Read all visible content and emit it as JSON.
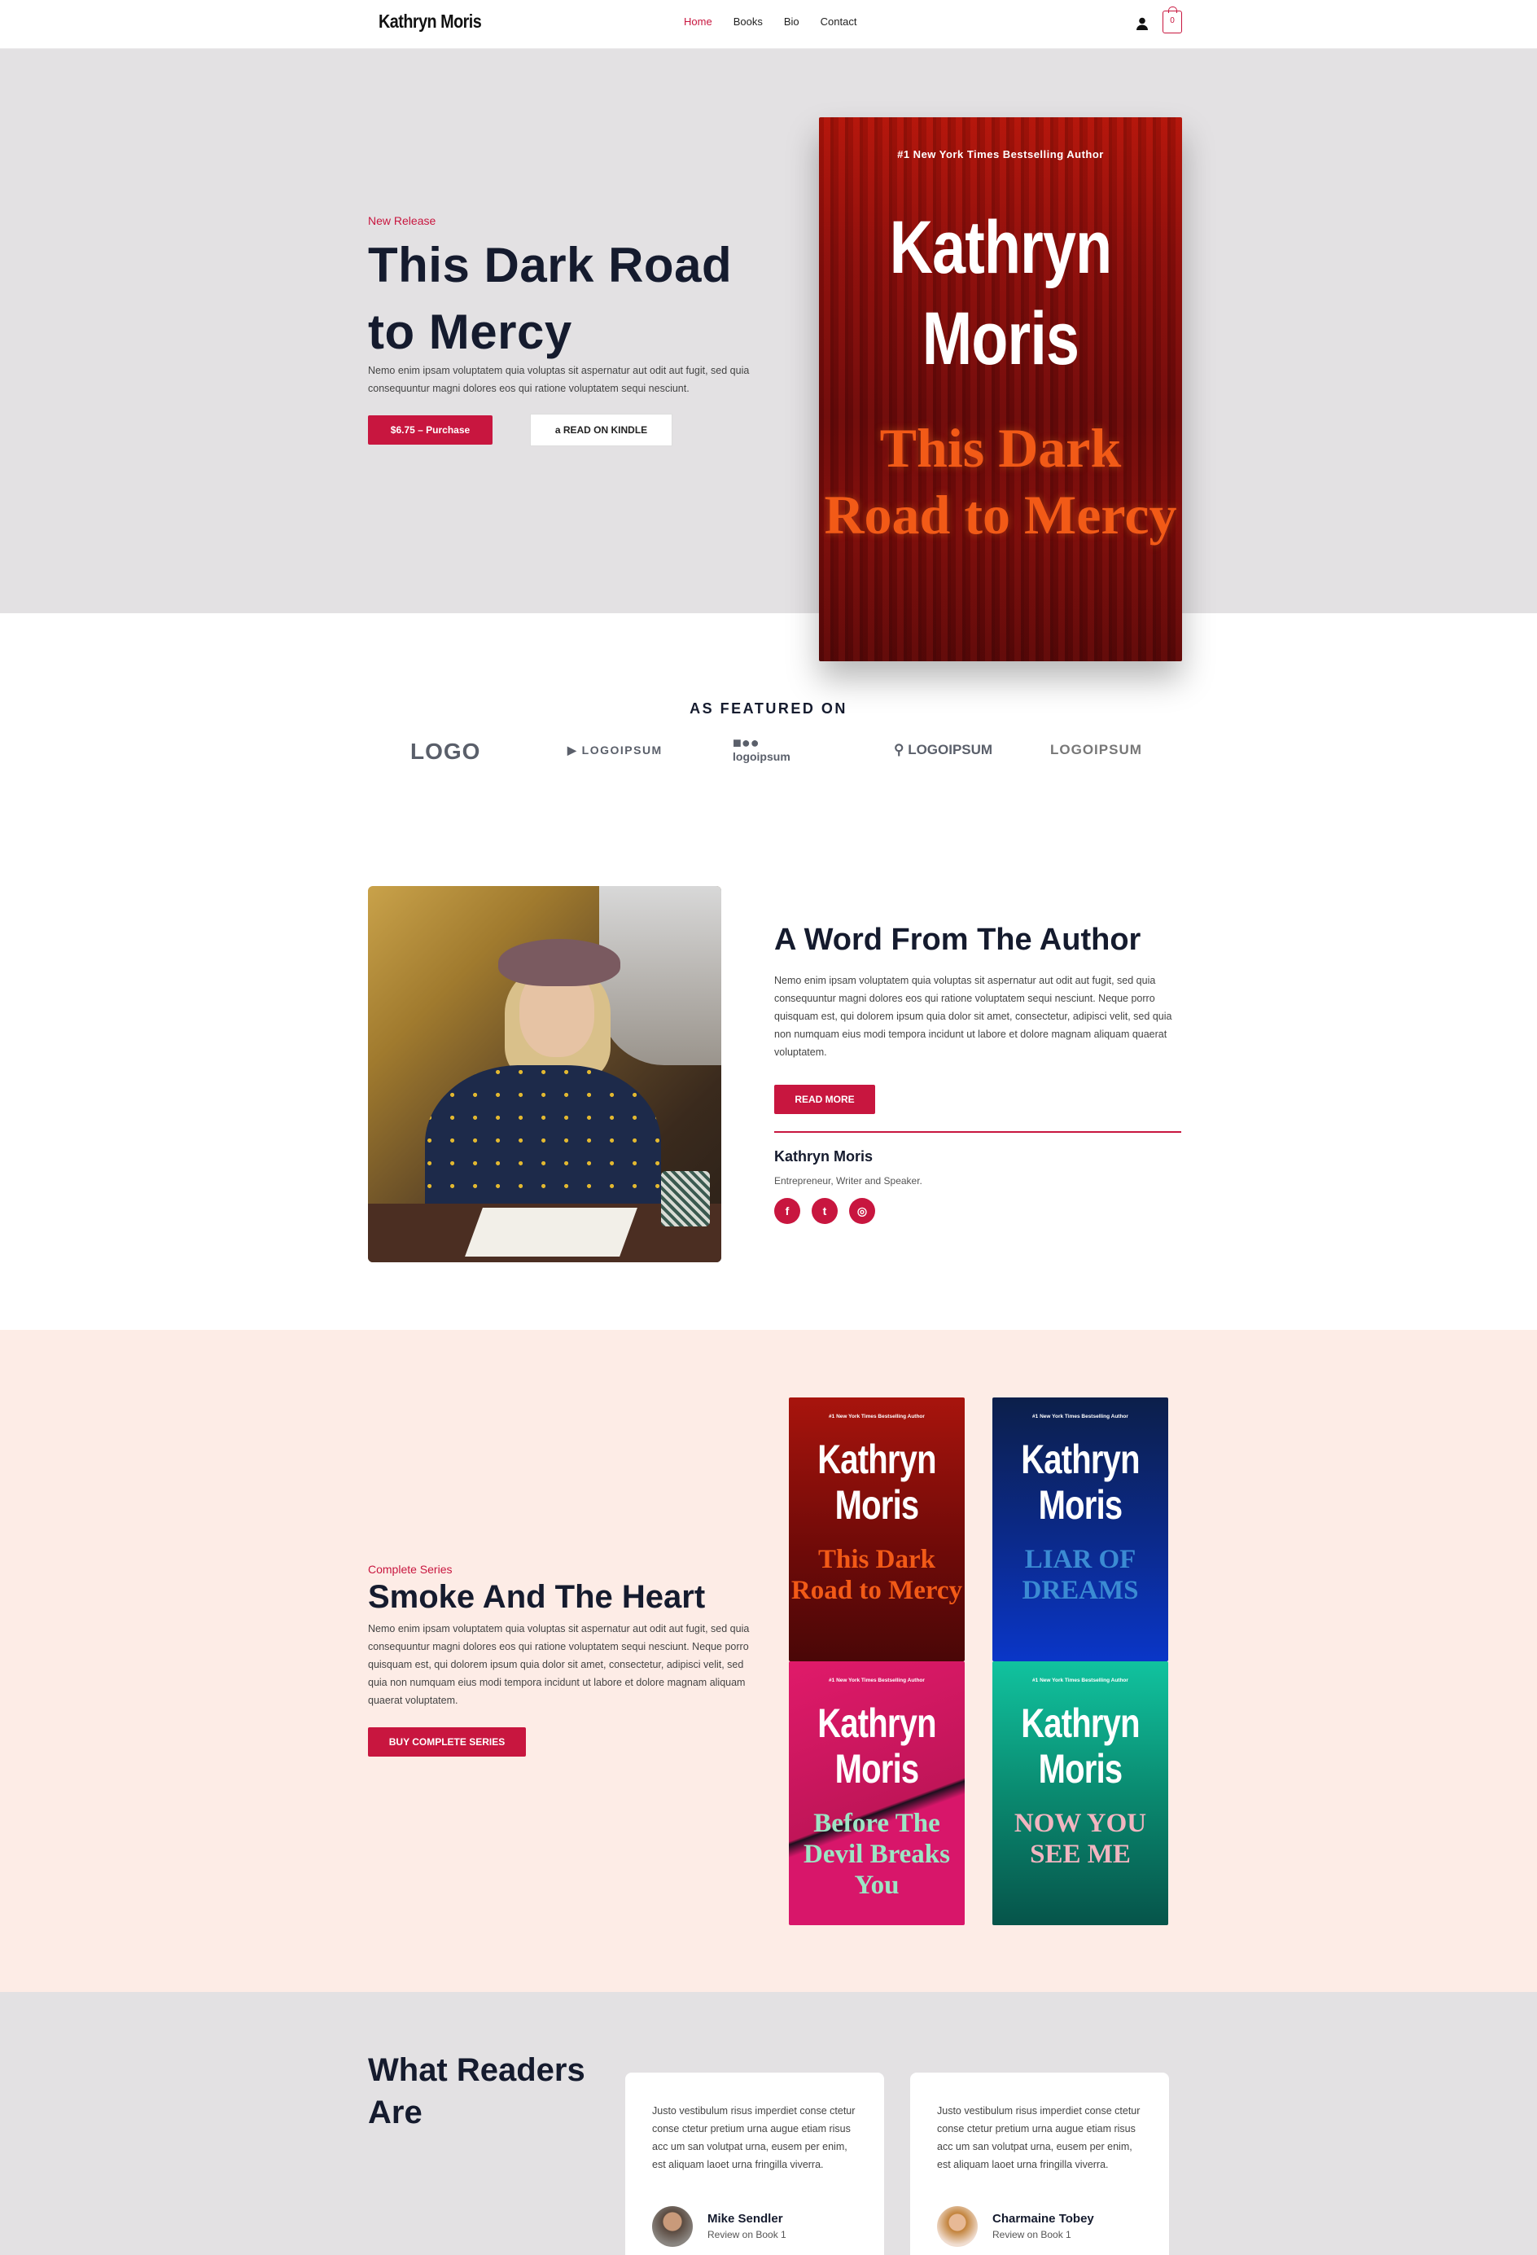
{
  "header": {
    "brand": "Kathryn Moris",
    "nav": [
      {
        "label": "Home",
        "active": true
      },
      {
        "label": "Books",
        "active": false
      },
      {
        "label": "Bio",
        "active": false
      },
      {
        "label": "Contact",
        "active": false
      }
    ],
    "user_icon": "user-icon",
    "cart_count": "0"
  },
  "hero": {
    "eyebrow": "New Release",
    "title": "This Dark Road to Mercy",
    "description": "Nemo enim ipsam voluptatem quia voluptas sit aspernatur aut odit aut fugit, sed quia consequuntur magni dolores eos qui ratione voluptatem sequi nesciunt.",
    "purchase_label": "$6.75 – Purchase",
    "kindle_label": "READ ON KINDLE",
    "kindle_icon": "amazon-icon",
    "cover": {
      "tag": "#1 New York Times Bestselling Author",
      "author": "Kathryn Moris",
      "title": "This Dark Road to Mercy"
    }
  },
  "featured": {
    "heading": "AS FEATURED ON",
    "logos": [
      "LOGO",
      "LOGOIPSUM",
      "logoipsum",
      "LOGOIPSUM",
      "LOGOIPSUM"
    ]
  },
  "author": {
    "heading": "A Word From The Author",
    "description": "Nemo enim ipsam voluptatem quia voluptas sit aspernatur aut odit aut fugit, sed quia consequuntur magni dolores eos qui ratione voluptatem sequi nesciunt. Neque porro quisquam est, qui dolorem ipsum quia dolor sit amet, consectetur, adipisci velit, sed quia non numquam eius modi tempora incidunt ut labore et dolore magnam aliquam quaerat voluptatem.",
    "read_more_label": "READ MORE",
    "name": "Kathryn Moris",
    "role": "Entrepreneur, Writer and Speaker.",
    "social": [
      "facebook-icon",
      "twitter-icon",
      "instagram-icon"
    ]
  },
  "series": {
    "eyebrow": "Complete Series",
    "title": "Smoke And The Heart",
    "description": "Nemo enim ipsam voluptatem quia voluptas sit aspernatur aut odit aut fugit, sed quia consequuntur magni dolores eos qui ratione voluptatem sequi nesciunt. Neque porro quisquam est, qui dolorem ipsum quia dolor sit amet, consectetur, adipisci velit, sed quia non numquam eius modi tempora incidunt ut labore et dolore magnam aliquam quaerat voluptatem.",
    "button_label": "BUY COMPLETE SERIES",
    "books": [
      {
        "tag": "#1 New York Times Bestselling Author",
        "author": "Kathryn Moris",
        "title": "This Dark Road to Mercy"
      },
      {
        "tag": "#1 New York Times Bestselling Author",
        "author": "Kathryn Moris",
        "title": "LIAR OF DREAMS"
      },
      {
        "tag": "#1 New York Times Bestselling Author",
        "author": "Kathryn Moris",
        "title": "Before The Devil Breaks You"
      },
      {
        "tag": "#1 New York Times Bestselling Author",
        "author": "Kathryn Moris",
        "title": "NOW YOU SEE ME"
      }
    ]
  },
  "reviews": {
    "heading": "What Readers Are",
    "items": [
      {
        "text": "Justo vestibulum risus imperdiet conse ctetur conse ctetur pretium urna augue etiam risus acc um san volutpat urna, eusem per enim, est aliquam laoet urna fringilla viverra.",
        "name": "Mike Sendler",
        "sub": "Review on Book 1"
      },
      {
        "text": "Justo vestibulum risus imperdiet conse ctetur conse ctetur pretium urna augue etiam risus acc um san volutpat urna, eusem per enim, est aliquam laoet urna fringilla viverra.",
        "name": "Charmaine Tobey",
        "sub": "Review on Book 1"
      }
    ]
  },
  "colors": {
    "accent": "#c8163f",
    "heading": "#151b2e",
    "hero_bg": "#e3e1e3",
    "series_bg": "#fdece6"
  }
}
